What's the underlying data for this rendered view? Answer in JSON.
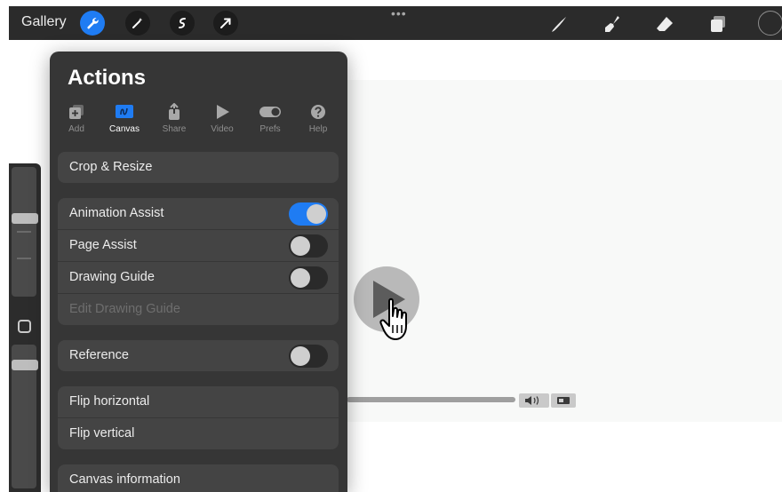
{
  "topbar": {
    "gallery_label": "Gallery",
    "tools": [
      "wrench-icon",
      "magic-wand-icon",
      "selection-icon",
      "transform-arrow-icon"
    ],
    "right_tools": [
      "brush-icon",
      "smudge-icon",
      "eraser-icon",
      "layers-icon",
      "color-circle"
    ],
    "more_dots": "•••",
    "accent": "#1f7cf3"
  },
  "actions": {
    "title": "Actions",
    "tabs": [
      {
        "label": "Add",
        "icon": "add-icon"
      },
      {
        "label": "Canvas",
        "icon": "canvas-icon"
      },
      {
        "label": "Share",
        "icon": "share-icon"
      },
      {
        "label": "Video",
        "icon": "video-icon"
      },
      {
        "label": "Prefs",
        "icon": "prefs-toggle-icon"
      },
      {
        "label": "Help",
        "icon": "help-icon"
      }
    ],
    "active_tab": "Canvas",
    "crop_resize": "Crop & Resize",
    "animation_assist": {
      "label": "Animation Assist",
      "on": true
    },
    "page_assist": {
      "label": "Page Assist",
      "on": false
    },
    "drawing_guide": {
      "label": "Drawing Guide",
      "on": false
    },
    "edit_drawing_guide": "Edit Drawing Guide",
    "reference": {
      "label": "Reference",
      "on": false
    },
    "flip_horizontal": "Flip horizontal",
    "flip_vertical": "Flip vertical",
    "canvas_information": "Canvas information"
  },
  "video": {
    "play_icon": "play-icon",
    "cursor_icon": "hand-cursor-icon",
    "volume_icon": "volume-icon",
    "fullscreen_icon": "fullscreen-icon"
  }
}
